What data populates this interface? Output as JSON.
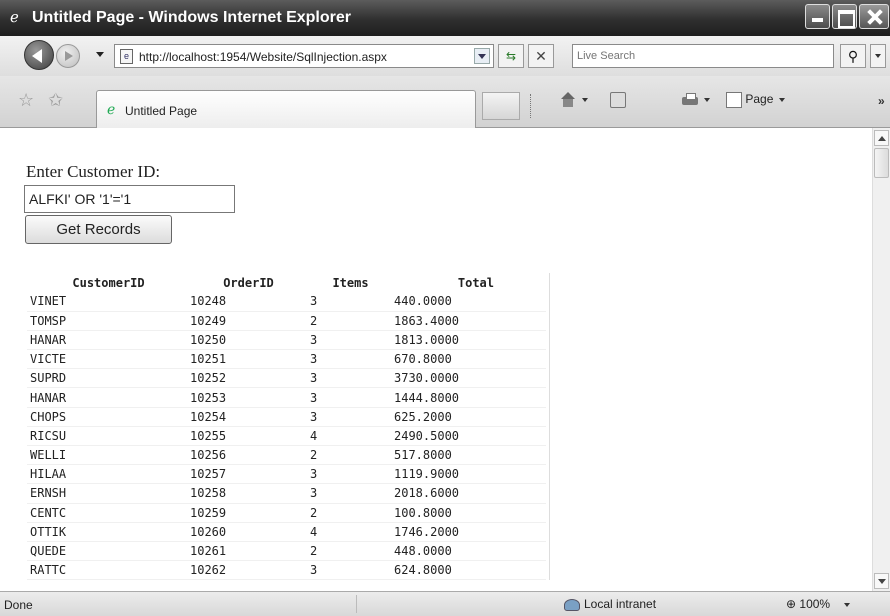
{
  "window": {
    "title": "Untitled Page - Windows Internet Explorer"
  },
  "nav": {
    "url": "http://localhost:1954/Website/SqlInjection.aspx",
    "search_placeholder": "Live Search"
  },
  "tabs": [
    {
      "label": "Untitled Page"
    }
  ],
  "commands": {
    "page_label": "Page"
  },
  "form": {
    "label": "Enter Customer ID:",
    "customer_id_value": "ALFKI' OR '1'='1",
    "button_label": "Get Records"
  },
  "table": {
    "headers": [
      "CustomerID",
      "OrderID",
      "Items",
      "Total"
    ],
    "rows": [
      [
        "VINET",
        "10248",
        "3",
        "440.0000"
      ],
      [
        "TOMSP",
        "10249",
        "2",
        "1863.4000"
      ],
      [
        "HANAR",
        "10250",
        "3",
        "1813.0000"
      ],
      [
        "VICTE",
        "10251",
        "3",
        "670.8000"
      ],
      [
        "SUPRD",
        "10252",
        "3",
        "3730.0000"
      ],
      [
        "HANAR",
        "10253",
        "3",
        "1444.8000"
      ],
      [
        "CHOPS",
        "10254",
        "3",
        "625.2000"
      ],
      [
        "RICSU",
        "10255",
        "4",
        "2490.5000"
      ],
      [
        "WELLI",
        "10256",
        "2",
        "517.8000"
      ],
      [
        "HILAA",
        "10257",
        "3",
        "1119.9000"
      ],
      [
        "ERNSH",
        "10258",
        "3",
        "2018.6000"
      ],
      [
        "CENTC",
        "10259",
        "2",
        "100.8000"
      ],
      [
        "OTTIK",
        "10260",
        "4",
        "1746.2000"
      ],
      [
        "QUEDE",
        "10261",
        "2",
        "448.0000"
      ],
      [
        "RATTC",
        "10262",
        "3",
        "624.8000"
      ]
    ]
  },
  "status": {
    "text": "Done",
    "zone": "Local intranet",
    "zoom": "100%"
  }
}
